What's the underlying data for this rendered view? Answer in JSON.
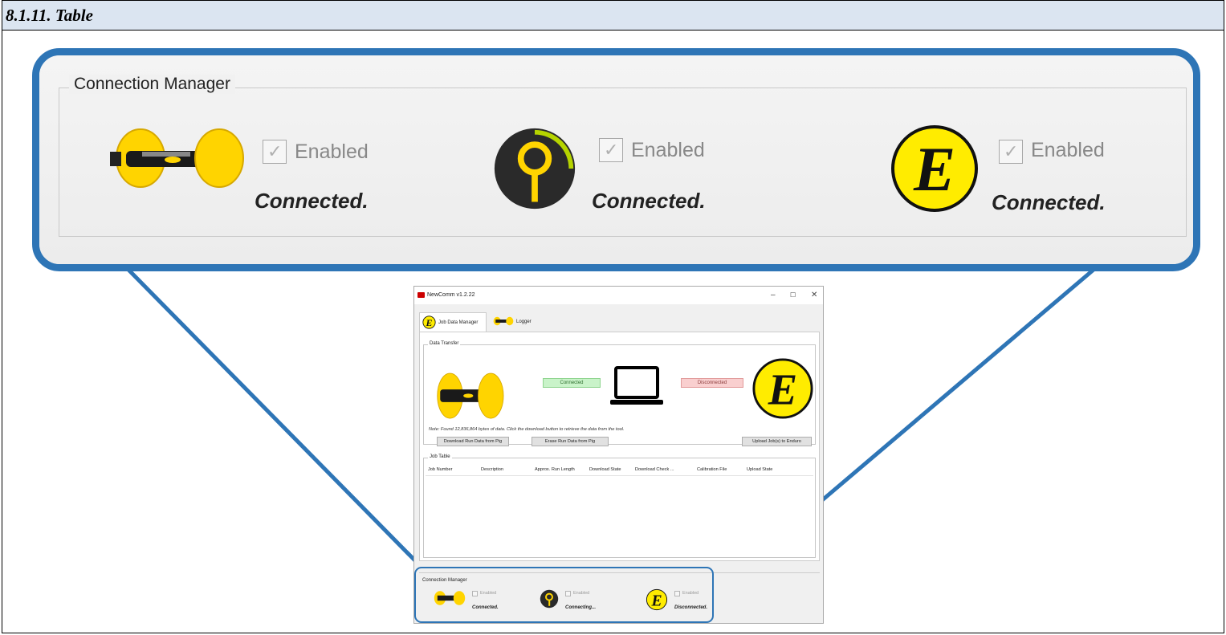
{
  "doc": {
    "section_title": "8.1.11. Table"
  },
  "zoom": {
    "group_title": "Connection Manager",
    "devices": [
      {
        "name": "pig",
        "enabled_label": "Enabled",
        "enabled": true,
        "status": "Connected."
      },
      {
        "name": "logger",
        "enabled_label": "Enabled",
        "enabled": true,
        "status": "Connected."
      },
      {
        "name": "enduro",
        "enabled_label": "Enabled",
        "enabled": true,
        "status": "Connected."
      }
    ]
  },
  "app": {
    "title": "NewComm v1.2.22",
    "window_controls": [
      "–",
      "☐",
      "✕"
    ],
    "tabs": [
      {
        "label": "Job Data Manager",
        "active": true
      },
      {
        "label": "Logger",
        "active": false
      }
    ],
    "data_transfer": {
      "title": "Data Transfer",
      "pig_status": "Connected",
      "enduro_status": "Disconnected",
      "note": "Note: Found 12,836,864 bytes of data. Click the download button to retrieve the data from the tool.",
      "buttons": {
        "download": "Download Run Data from Pig",
        "erase": "Erase Run Data from Pig",
        "upload": "Upload Job(s) to Enduro"
      }
    },
    "job_table": {
      "title": "Job Table",
      "columns": [
        "Job Number",
        "Description",
        "Approx. Run Length",
        "Download State",
        "Download Check ...",
        "Calibration File",
        "Upload State"
      ]
    },
    "connection_manager": {
      "title": "Connection Manager",
      "devices": [
        {
          "name": "pig",
          "enabled_label": "Enabled",
          "status": "Connected."
        },
        {
          "name": "logger",
          "enabled_label": "Enabled",
          "status": "Connecting..."
        },
        {
          "name": "enduro",
          "enabled_label": "Enabled",
          "status": "Disconnected."
        }
      ]
    }
  },
  "colors": {
    "callout": "#2e75b6",
    "device_yellow": "#ffd800",
    "header_bg": "#dbe5f1"
  }
}
